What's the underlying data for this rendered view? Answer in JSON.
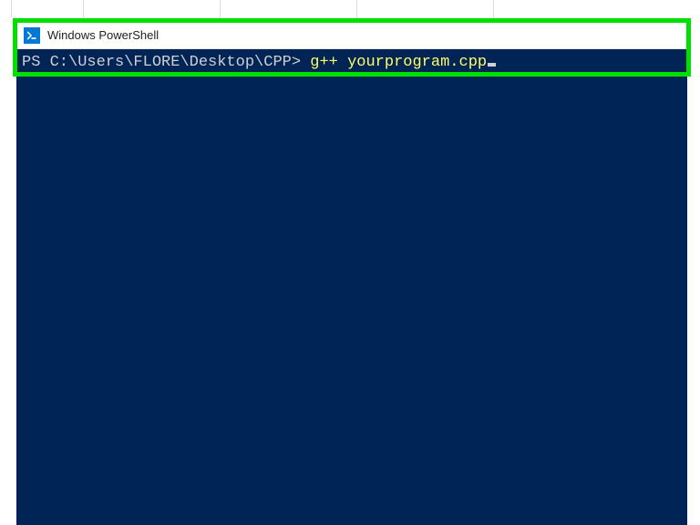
{
  "window": {
    "title": "Windows PowerShell"
  },
  "terminal": {
    "prompt": "PS C:\\Users\\FLORE\\Desktop\\CPP> ",
    "command": "g++ yourprogram.cpp"
  }
}
